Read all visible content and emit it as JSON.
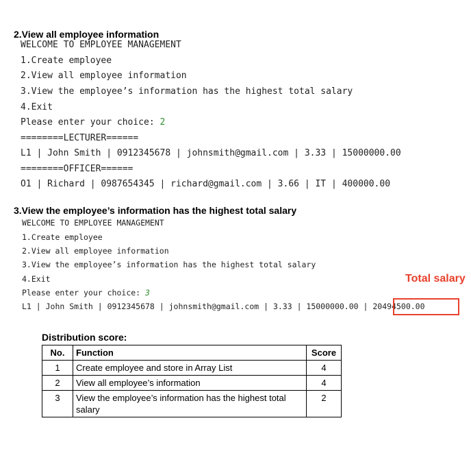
{
  "section2": {
    "title": "2.View all employee information",
    "console": {
      "welcome": "WELCOME TO EMPLOYEE MANAGEMENT",
      "menu": [
        "1.Create employee",
        "2.View all employee information",
        "3.View the employee’s information has the highest total salary",
        "4.Exit"
      ],
      "prompt": "Please enter your choice: ",
      "choice": "2",
      "lecturer_header": "========LECTURER======",
      "lecturer_row": "L1 | John Smith | 0912345678 | johnsmith@gmail.com | 3.33 | 15000000.00",
      "officer_header": "========OFFICER======",
      "officer_row": "O1 | Richard | 0987654345 | richard@gmail.com | 3.66 | IT | 400000.00"
    }
  },
  "section3": {
    "title": "3.View the employee’s information has the highest total salary",
    "console": {
      "welcome": "WELCOME TO EMPLOYEE MANAGEMENT",
      "menu": [
        "1.Create employee",
        "2.View all employee information",
        "3.View the employee’s information has the highest total salary",
        "4.Exit"
      ],
      "prompt": "Please enter your choice: ",
      "choice": "3",
      "result_row": "L1 | John Smith | 0912345678 | johnsmith@gmail.com | 3.33 | 15000000.00 | ",
      "total_salary_value": "20494500.00"
    },
    "annotation": "Total salary",
    "annotation_color": "#e8412c"
  },
  "distribution": {
    "title": "Distribution score:",
    "headers": [
      "No.",
      "Function",
      "Score"
    ],
    "rows": [
      {
        "no": "1",
        "function": "Create employee and store in Array List",
        "score": "4"
      },
      {
        "no": "2",
        "function": "View all employee’s information",
        "score": "4"
      },
      {
        "no": "3",
        "function": "View the employee’s information has the highest total salary",
        "score": "2"
      }
    ]
  }
}
